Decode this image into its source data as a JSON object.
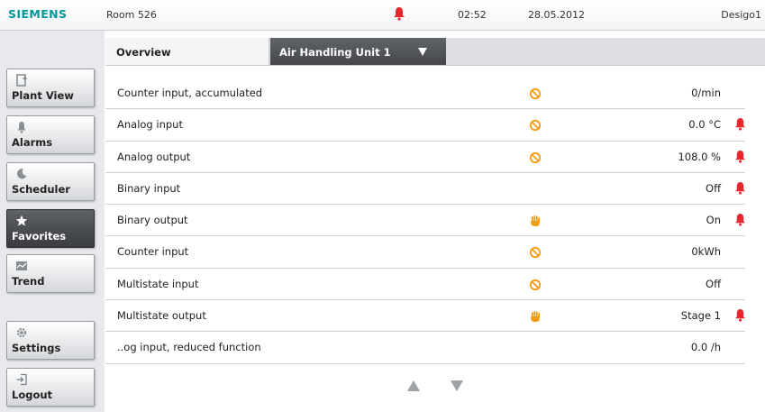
{
  "topbar": {
    "brand": "SIEMENS",
    "room": "Room 526",
    "time": "02:52",
    "date": "28.05.2012",
    "user": "Desigo1",
    "alarm_icon": "bell-icon",
    "alarm_color": "#e8262d"
  },
  "sidebar": {
    "items": [
      {
        "label": "Plant View",
        "icon": "plant-view-icon"
      },
      {
        "label": "Alarms",
        "icon": "bell-icon"
      },
      {
        "label": "Scheduler",
        "icon": "moon-icon"
      },
      {
        "label": "Favorites",
        "icon": "star-icon",
        "active": true
      },
      {
        "label": "Trend",
        "icon": "trend-icon"
      },
      {
        "label": "Settings",
        "icon": "gear-icon"
      },
      {
        "label": "Logout",
        "icon": "logout-icon"
      }
    ]
  },
  "header": {
    "tab": "Overview",
    "unit_selected": "Air Handling Unit 1"
  },
  "list": {
    "rows": [
      {
        "name": "Counter input, accumulated",
        "status": "out-of-service",
        "value": "0/min",
        "alarm": false
      },
      {
        "name": "Analog input",
        "status": "out-of-service",
        "value": "0.0 °C",
        "alarm": true
      },
      {
        "name": "Analog output",
        "status": "out-of-service",
        "value": "108.0 %",
        "alarm": true
      },
      {
        "name": "Binary input",
        "status": "",
        "value": "Off",
        "alarm": true
      },
      {
        "name": "Binary output",
        "status": "manual",
        "value": "On",
        "alarm": true
      },
      {
        "name": "Counter input",
        "status": "out-of-service",
        "value": "0kWh",
        "alarm": false
      },
      {
        "name": "Multistate input",
        "status": "out-of-service",
        "value": "Off",
        "alarm": false
      },
      {
        "name": "Multistate output",
        "status": "manual",
        "value": "Stage 1",
        "alarm": true
      },
      {
        "name": "..og input, reduced function",
        "status": "",
        "value": "0.0 /h",
        "alarm": false
      }
    ]
  },
  "colors": {
    "brand": "#009999",
    "status_orange": "#f39c12",
    "alarm_red": "#e8262d"
  }
}
